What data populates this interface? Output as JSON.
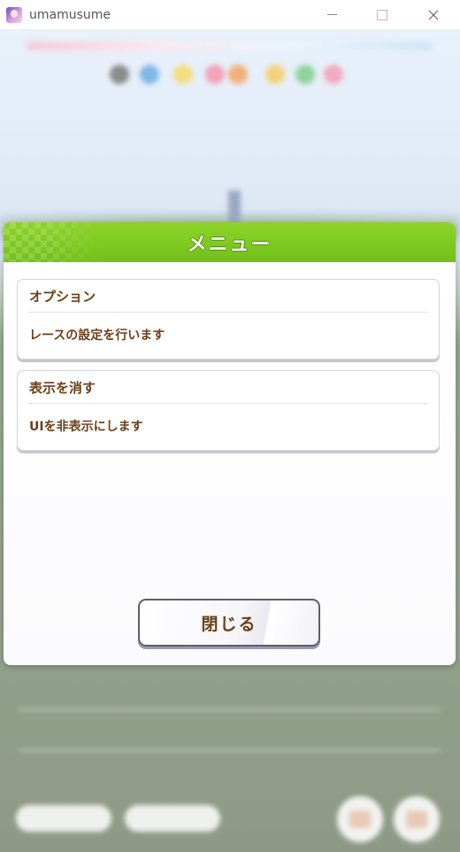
{
  "window": {
    "title": "umamusume",
    "icon": "app-icon",
    "controls": [
      "minimize-icon",
      "maximize-icon",
      "close-icon"
    ]
  },
  "menu": {
    "title": "メニュー",
    "items": [
      {
        "title": "オプション",
        "description": "レースの設定を行います"
      },
      {
        "title": "表示を消す",
        "description": "UIを非表示にします"
      }
    ],
    "close_label": "閉じる"
  },
  "colors": {
    "header_green": "#7ec720",
    "text_brown": "#6b3f17",
    "dialog_bg": "#ffffff"
  }
}
